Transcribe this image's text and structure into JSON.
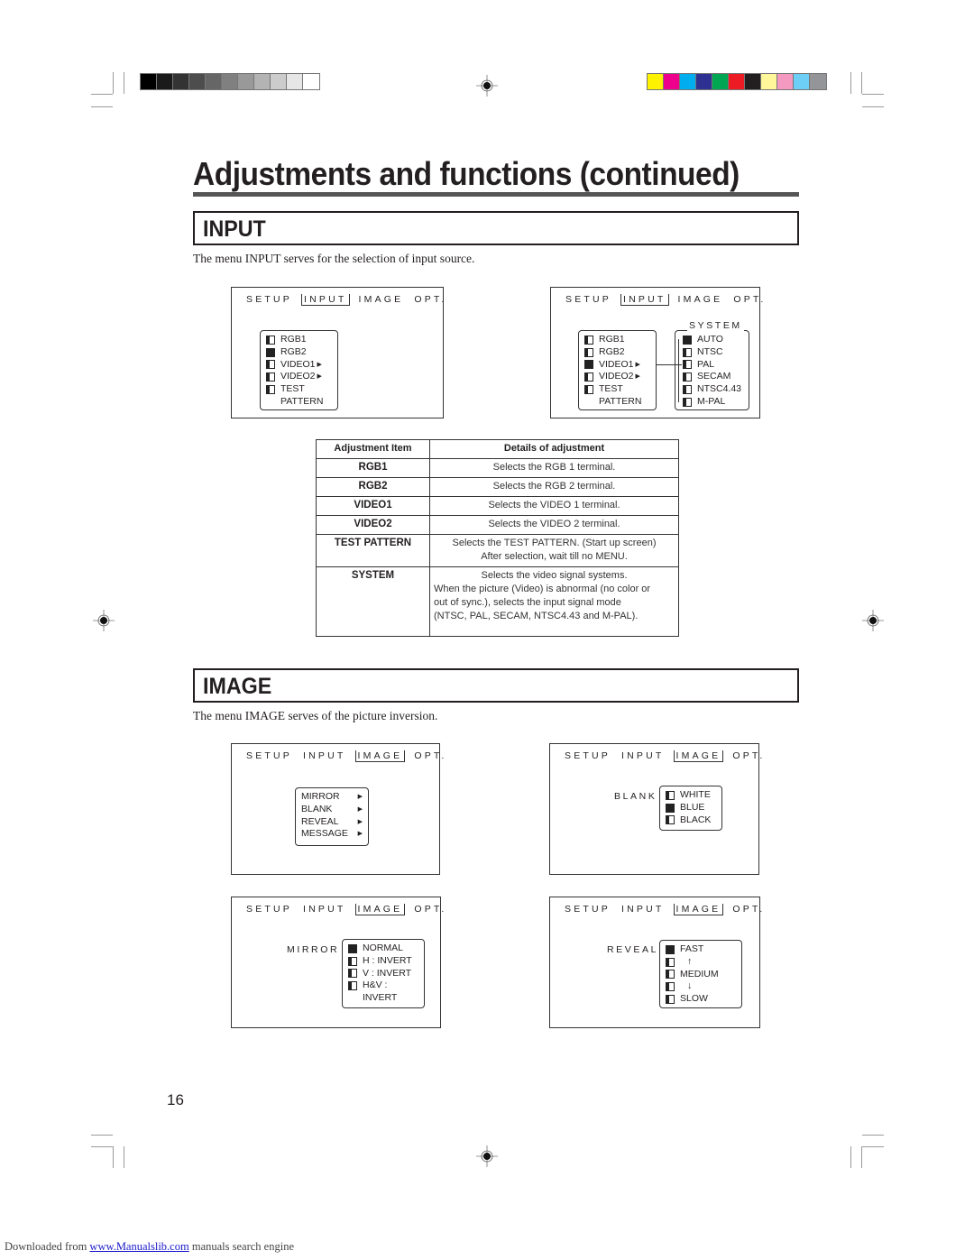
{
  "print_marks": {
    "gray_swatches": [
      "#000000",
      "#1a1a1a",
      "#333333",
      "#4d4d4d",
      "#666666",
      "#808080",
      "#999999",
      "#b3b3b3",
      "#cccccc",
      "#e6e6e6",
      "#ffffff"
    ],
    "color_swatches": [
      "#fff200",
      "#ec008c",
      "#00aeef",
      "#2e3192",
      "#00a651",
      "#ed1c24",
      "#231f20",
      "#fff799",
      "#f49ac1",
      "#6dcff6",
      "#939598"
    ]
  },
  "page": {
    "title": "Adjustments and functions (continued)",
    "page_number": "16"
  },
  "input_section": {
    "heading": "INPUT",
    "intro": "The menu INPUT serves for the selection of input source.",
    "screens": [
      {
        "menubar": [
          "SETUP",
          "INPUT",
          "IMAGE",
          "OPT."
        ],
        "active": "INPUT",
        "options": [
          {
            "label": "RGB1",
            "state": "half",
            "submenu": false
          },
          {
            "label": "RGB2",
            "state": "full",
            "submenu": false
          },
          {
            "label": "VIDEO1",
            "state": "half",
            "submenu": true
          },
          {
            "label": "VIDEO2",
            "state": "half",
            "submenu": true
          },
          {
            "label": "TEST",
            "state": "half",
            "submenu": false
          },
          {
            "label": "PATTERN",
            "state": "none",
            "submenu": false
          }
        ]
      },
      {
        "menubar": [
          "SETUP",
          "INPUT",
          "IMAGE",
          "OPT."
        ],
        "active": "INPUT",
        "options": [
          {
            "label": "RGB1",
            "state": "half",
            "submenu": false
          },
          {
            "label": "RGB2",
            "state": "half",
            "submenu": false
          },
          {
            "label": "VIDEO1",
            "state": "full",
            "submenu": true
          },
          {
            "label": "VIDEO2",
            "state": "half",
            "submenu": true
          },
          {
            "label": "TEST",
            "state": "half",
            "submenu": false
          },
          {
            "label": "PATTERN",
            "state": "none",
            "submenu": false
          }
        ],
        "submenu_title": "SYSTEM",
        "submenu_options": [
          {
            "label": "AUTO",
            "state": "full"
          },
          {
            "label": "NTSC",
            "state": "half"
          },
          {
            "label": "PAL",
            "state": "half"
          },
          {
            "label": "SECAM",
            "state": "half"
          },
          {
            "label": "NTSC4.43",
            "state": "half"
          },
          {
            "label": "M-PAL",
            "state": "half"
          }
        ]
      }
    ],
    "table": {
      "headers": [
        "Adjustment Item",
        "Details of adjustment"
      ],
      "rows": [
        {
          "item": "RGB1",
          "details": [
            "Selects the RGB 1 terminal."
          ]
        },
        {
          "item": "RGB2",
          "details": [
            "Selects the RGB 2 terminal."
          ]
        },
        {
          "item": "VIDEO1",
          "details": [
            "Selects the VIDEO 1 terminal."
          ]
        },
        {
          "item": "VIDEO2",
          "details": [
            "Selects the VIDEO 2 terminal."
          ]
        },
        {
          "item": "TEST PATTERN",
          "details": [
            "Selects the TEST PATTERN. (Start up screen)",
            "After selection, wait till no MENU."
          ]
        },
        {
          "item": "SYSTEM",
          "details": [
            "Selects the video signal systems.",
            "When the picture (Video) is abnormal (no color or",
            "out of sync.), selects the input signal mode",
            "(NTSC, PAL, SECAM, NTSC4.43 and M-PAL)."
          ]
        }
      ]
    }
  },
  "image_section": {
    "heading": "IMAGE",
    "intro": "The menu IMAGE serves of the picture inversion.",
    "screens": [
      {
        "menubar": [
          "SETUP",
          "INPUT",
          "IMAGE",
          "OPT."
        ],
        "active": "IMAGE",
        "prefix": "",
        "options": [
          {
            "label": "MIRROR",
            "state": "submenu"
          },
          {
            "label": "BLANK",
            "state": "submenu"
          },
          {
            "label": "REVEAL",
            "state": "submenu"
          },
          {
            "label": "MESSAGE",
            "state": "submenu"
          }
        ]
      },
      {
        "menubar": [
          "SETUP",
          "INPUT",
          "IMAGE",
          "OPT."
        ],
        "active": "IMAGE",
        "prefix": "BLANK",
        "options": [
          {
            "label": "WHITE",
            "state": "half"
          },
          {
            "label": "BLUE",
            "state": "full"
          },
          {
            "label": "BLACK",
            "state": "half"
          }
        ]
      },
      {
        "menubar": [
          "SETUP",
          "INPUT",
          "IMAGE",
          "OPT."
        ],
        "active": "IMAGE",
        "prefix": "MIRROR",
        "options": [
          {
            "label": "NORMAL",
            "state": "full"
          },
          {
            "label": "H : INVERT",
            "state": "half"
          },
          {
            "label": "V : INVERT",
            "state": "half"
          },
          {
            "label": "H&V :",
            "state": "half"
          },
          {
            "label": "INVERT",
            "state": "none"
          }
        ]
      },
      {
        "menubar": [
          "SETUP",
          "INPUT",
          "IMAGE",
          "OPT."
        ],
        "active": "IMAGE",
        "prefix": "REVEAL",
        "options": [
          {
            "label": "FAST",
            "state": "full"
          },
          {
            "label": "↑",
            "state": "half"
          },
          {
            "label": "MEDIUM",
            "state": "half"
          },
          {
            "label": "↓",
            "state": "half"
          },
          {
            "label": "SLOW",
            "state": "half"
          }
        ]
      }
    ]
  },
  "footer": {
    "prefix": "Downloaded from ",
    "link": "www.Manualslib.com",
    "suffix": " manuals search engine"
  }
}
